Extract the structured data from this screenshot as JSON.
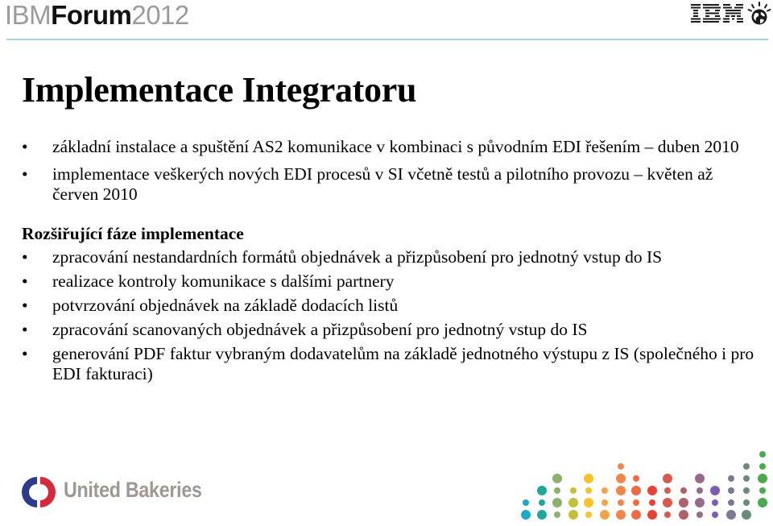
{
  "header": {
    "brand_light_1": "IBM",
    "brand_bold": "Forum",
    "brand_light_2": "2012",
    "logo_text": "IBM"
  },
  "slide": {
    "title": "Implementace Integratoru",
    "group1": [
      {
        "text": "základní instalace a spuštění AS2 komunikace v kombinaci s původním EDI řešením – duben 2010"
      },
      {
        "text": "implementace veškerých nových EDI procesů v SI včetně testů a pilotního provozu – květen až červen 2010"
      }
    ],
    "section_heading": "Rozšiřující fáze implementace",
    "group2": [
      {
        "text": "zpracování nestandardních formátů objednávek a přizpůsobení pro jednotný vstup do IS"
      },
      {
        "text": "realizace kontroly komunikace s dalšími partnery"
      },
      {
        "text": "potvrzování objednávek na základě dodacích listů"
      },
      {
        "text": "zpracování scanovaných objednávek a přizpůsobení pro jednotný vstup do IS"
      },
      {
        "text": "generování PDF faktur vybraným dodavatelům na základě jednotného výstupu z IS (společného i pro EDI fakturaci)"
      }
    ],
    "bullet": "•"
  },
  "footer": {
    "company_name": "United Bakeries",
    "logo_colors": {
      "left": "#2e3a8c",
      "right": "#d42a3c"
    },
    "dot_palette": [
      "#1ea7c6",
      "#22a79a",
      "#8bb26a",
      "#c3c13c",
      "#f6c32c",
      "#f4a24a",
      "#f1864a",
      "#ee6a45",
      "#e8413a",
      "#d65a4e",
      "#b0606a",
      "#966a8c",
      "#7a5fb0",
      "#7a7a98",
      "#6b8a78",
      "#4aaa4c"
    ]
  }
}
